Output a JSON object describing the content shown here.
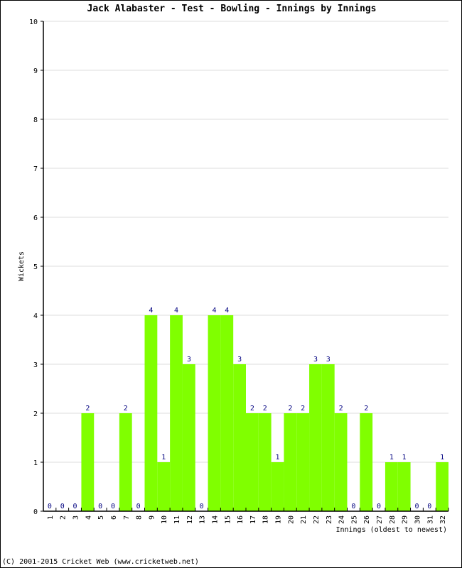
{
  "chart_data": {
    "type": "bar",
    "title": "Jack Alabaster - Test - Bowling - Innings by Innings",
    "xlabel": "Innings (oldest to newest)",
    "ylabel": "Wickets",
    "ylim": [
      0,
      10
    ],
    "yticks": [
      0,
      1,
      2,
      3,
      4,
      5,
      6,
      7,
      8,
      9,
      10
    ],
    "grid": true,
    "categories": [
      "1",
      "2",
      "3",
      "4",
      "5",
      "6",
      "7",
      "8",
      "9",
      "10",
      "11",
      "12",
      "13",
      "14",
      "15",
      "16",
      "17",
      "18",
      "19",
      "20",
      "21",
      "22",
      "23",
      "24",
      "25",
      "26",
      "27",
      "28",
      "29",
      "30",
      "31",
      "32"
    ],
    "values": [
      0,
      0,
      0,
      2,
      0,
      0,
      2,
      0,
      4,
      1,
      4,
      3,
      0,
      4,
      4,
      3,
      2,
      2,
      1,
      2,
      2,
      3,
      3,
      2,
      0,
      2,
      0,
      1,
      1,
      0,
      0,
      1
    ],
    "bar_color": "#80ff00",
    "label_color": "#000080"
  },
  "footer": "(C) 2001-2015 Cricket Web (www.cricketweb.net)"
}
